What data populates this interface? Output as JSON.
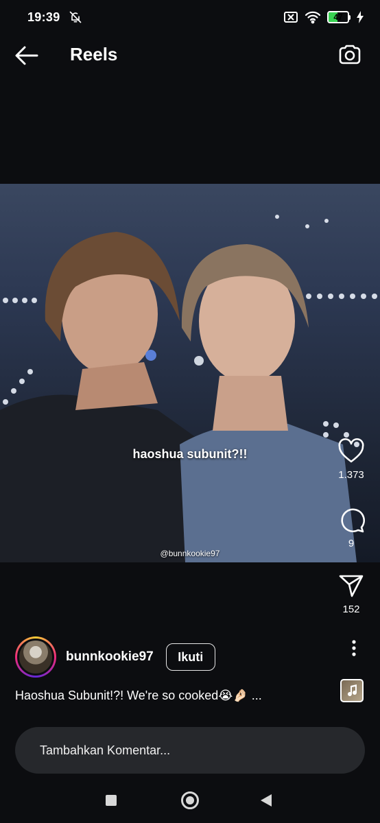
{
  "status_bar": {
    "time": "19:39",
    "battery_level": "47",
    "battery_fraction": 0.47,
    "icons": [
      "bell-off-icon",
      "sim-x-icon",
      "wifi-icon",
      "battery-icon",
      "charging-bolt-icon"
    ]
  },
  "header": {
    "title": "Reels",
    "back_icon": "arrow-left-icon",
    "camera_icon": "camera-icon"
  },
  "video": {
    "overlay_text": "haoshua subunit?!!",
    "watermark": "@bunnkookie97"
  },
  "actions": {
    "like_count": "1.373",
    "comment_count": "9",
    "share_count": "152"
  },
  "author": {
    "username": "bunnkookie97",
    "follow_label": "Ikuti"
  },
  "caption": {
    "text": "Haoshua Subunit!?! We're so cooked😭🤌🏻 ..."
  },
  "comment_input": {
    "placeholder": "Tambahkan Komentar..."
  },
  "colors": {
    "background": "#0c0d10",
    "input_bg": "#26282c",
    "battery": "#39d353"
  }
}
